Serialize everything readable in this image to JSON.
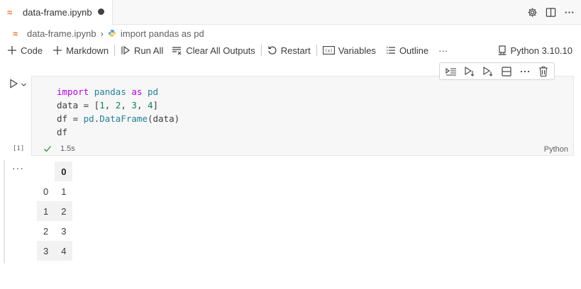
{
  "tab": {
    "filename": "data-frame.ipynb"
  },
  "breadcrumb": {
    "file": "data-frame.ipynb",
    "symbol": "import pandas as pd"
  },
  "toolbar": {
    "add_code": "Code",
    "add_markdown": "Markdown",
    "run_all": "Run All",
    "clear_outputs": "Clear All Outputs",
    "restart": "Restart",
    "variables": "Variables",
    "outline": "Outline",
    "more": "···",
    "kernel": "Python 3.10.10"
  },
  "cell": {
    "execution_count": "[1]",
    "duration": "1.5s",
    "language": "Python",
    "code": {
      "line1_kw1": "import",
      "line1_mod": "pandas",
      "line1_kw2": "as",
      "line1_alias": "pd",
      "line2_var": "data",
      "line2_eq": " = [",
      "line2_n1": "1",
      "line2_n2": "2",
      "line2_n3": "3",
      "line2_n4": "4",
      "line2_end": "]",
      "line3_var": "df",
      "line3_eq": " = ",
      "line3_pd": "pd",
      "line3_dot": ".",
      "line3_fn": "DataFrame",
      "line3_args": "(data)",
      "line4": "df"
    }
  },
  "output": {
    "more": "···",
    "columns": [
      "0"
    ],
    "index": [
      "0",
      "1",
      "2",
      "3"
    ],
    "values": [
      "1",
      "2",
      "3",
      "4"
    ]
  },
  "colors": {
    "keyword": "#af00db",
    "module": "#267f99",
    "number": "#098658",
    "function": "#795e26",
    "success": "#388a34",
    "file_icon": "#e37933"
  }
}
